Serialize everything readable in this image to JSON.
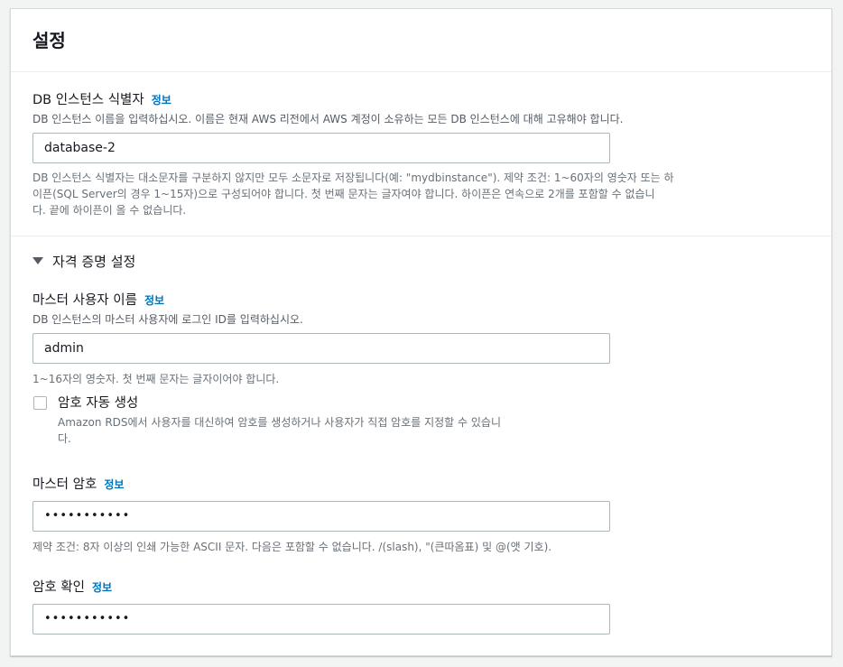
{
  "panel": {
    "title": "설정"
  },
  "db_identifier": {
    "label": "DB 인스턴스 식별자",
    "info": "정보",
    "description": "DB 인스턴스 이름을 입력하십시오. 이름은 현재 AWS 리전에서 AWS 계정이 소유하는 모든 DB 인스턴스에 대해 고유해야 합니다.",
    "value": "database-2",
    "constraint_line1": "DB 인스턴스 식별자는 대소문자를 구분하지 않지만 모두 소문자로 저장됩니다(예: \"mydbinstance\"). 제약 조건: 1~60자의 영숫자 또는 하",
    "constraint_line2": "이픈(SQL Server의 경우 1~15자)으로 구성되어야 합니다. 첫 번째 문자는 글자여야 합니다. 하이픈은 연속으로 2개를 포함할 수 없습니",
    "constraint_line3": "다. 끝에 하이픈이 올 수 없습니다."
  },
  "credentials": {
    "section_label": "자격 증명 설정",
    "master_username": {
      "label": "마스터 사용자 이름",
      "info": "정보",
      "description": "DB 인스턴스의 마스터 사용자에 로그인 ID를 입력하십시오.",
      "value": "admin",
      "constraint": "1~16자의 영숫자. 첫 번째 문자는 글자이어야 합니다."
    },
    "auto_password": {
      "label": "암호 자동 생성",
      "checked": false,
      "description_line1": "Amazon RDS에서 사용자를 대신하여 암호를 생성하거나 사용자가 직접 암호를 지정할 수 있습니",
      "description_line2": "다."
    },
    "master_password": {
      "label": "마스터 암호",
      "info": "정보",
      "value": "•••••••••••",
      "constraint": "제약 조건: 8자 이상의 인쇄 가능한 ASCII 문자. 다음은 포함할 수 없습니다. /(slash), \"(큰따옴표) 및 @(앳 기호)."
    },
    "confirm_password": {
      "label": "암호 확인",
      "info": "정보",
      "value": "•••••••••••"
    }
  }
}
